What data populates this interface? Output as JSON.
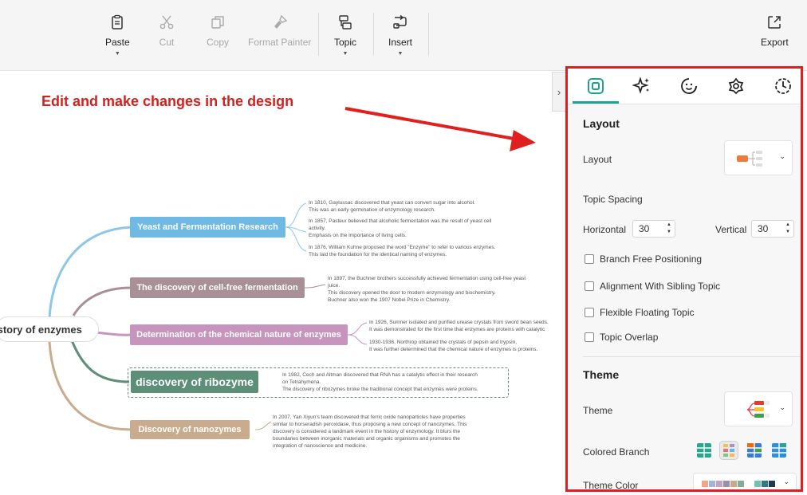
{
  "toolbar": {
    "paste": "Paste",
    "cut": "Cut",
    "copy": "Copy",
    "format_painter": "Format Painter",
    "topic": "Topic",
    "insert": "Insert",
    "export": "Export"
  },
  "annotation": "Edit and make changes in the design",
  "mindmap": {
    "root": "istory of enzymes",
    "branches": [
      {
        "label": "Yeast and Fermentation Research",
        "color": "#6fb9e4",
        "notes": [
          "In 1810, Gaylussac discovered that yeast can convert sugar into alcohol.",
          "This was an early germination of enzymology research.",
          "In 1857, Pasteur believed that alcoholic fermentation was the result of yeast cell",
          "activity.",
          "Emphasis on the importance of living cells.",
          "In 1876, William Kuhne proposed the word \"Enzyme\" to refer to various enzymes.",
          "This laid the foundation for the identical naming of enzymes."
        ]
      },
      {
        "label": "The discovery of cell-free fermentation",
        "color": "#a98f96",
        "notes": [
          "In 1897, the Buchner brothers successfully achieved fermentation using cell-free yeast",
          "juice.",
          "This discovery opened the door to modern enzymology and biochemistry.",
          "Buchner also won the 1907 Nobel Prize in Chemistry."
        ]
      },
      {
        "label": "Determination of the chemical nature of enzymes",
        "color": "#c794be",
        "notes": [
          "In 1926, Sumner isolated and purified urease crystals from sword bean seeds.",
          "It was demonstrated for the first time that enzymes are proteins with catalytic",
          "1930-1936, Northrop obtained the crystals of pepsin and trypsin,",
          "It was further determined that the chemical nature of enzymes is proteins."
        ]
      },
      {
        "label": "discovery of ribozyme",
        "color": "#5d8f78",
        "notes": [
          "In 1982, Cech and Altman discovered that RNA has a catalytic effect in their research",
          "on Tetrahymena.",
          "The discovery of ribozymes broke the traditional concept that enzymes were proteins."
        ]
      },
      {
        "label": "Discovery of nanozymes",
        "color": "#c9ab8d",
        "notes": [
          "In 2007, Yan Xiyun's team discovered that ferric oxide nanoparticles have properties",
          "similar to horseradish peroxidase, thus proposing a new concept of nanozymes. This",
          "discovery is considered a landmark event in the history of enzymology. It blurs the",
          "boundaries between inorganic materials and organic organisms and promotes the",
          "integration of nanoscience and medicine."
        ]
      }
    ]
  },
  "panel": {
    "layout_heading": "Layout",
    "layout_label": "Layout",
    "topic_spacing": "Topic Spacing",
    "horizontal_label": "Horizontal",
    "horizontal_value": "30",
    "vertical_label": "Vertical",
    "vertical_value": "30",
    "checkboxes": [
      "Branch Free Positioning",
      "Alignment With Sibling Topic",
      "Flexible Floating Topic",
      "Topic Overlap"
    ],
    "theme_heading": "Theme",
    "theme_label": "Theme",
    "colored_branch_label": "Colored Branch",
    "theme_color_label": "Theme Color",
    "accent": "#1fa38e"
  }
}
